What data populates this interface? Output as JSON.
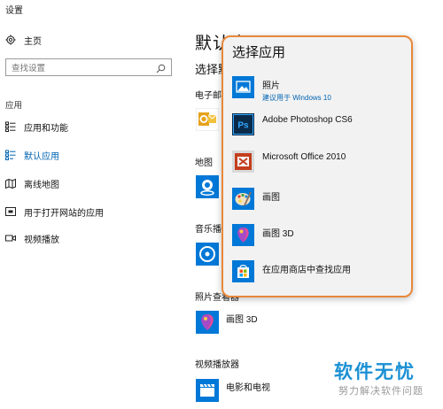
{
  "window": {
    "title": "设置"
  },
  "sidebar": {
    "home_label": "主页",
    "search_placeholder": "查找设置",
    "section_label": "应用",
    "items": [
      {
        "label": "应用和功能",
        "icon": "apps-list-icon"
      },
      {
        "label": "默认应用",
        "icon": "default-apps-icon",
        "active": true
      },
      {
        "label": "离线地图",
        "icon": "offline-map-icon"
      },
      {
        "label": "用于打开网站的应用",
        "icon": "website-apps-icon"
      },
      {
        "label": "视频播放",
        "icon": "video-icon"
      }
    ]
  },
  "main": {
    "title": "默认应用",
    "subtitle": "选择默认应用",
    "categories": [
      {
        "label": "电子邮件"
      },
      {
        "label": "地图"
      },
      {
        "label": "音乐播放器"
      },
      {
        "label": "照片查看器",
        "app": "画图 3D"
      },
      {
        "label": "视频播放器",
        "app": "电影和电视"
      }
    ]
  },
  "flyout": {
    "title": "选择应用",
    "items": [
      {
        "name": "照片",
        "sub": "建议用于 Windows 10",
        "icon": "photos-icon"
      },
      {
        "name": "Adobe Photoshop CS6",
        "icon": "photoshop-icon"
      },
      {
        "name": "Microsoft Office 2010",
        "icon": "office-icon"
      },
      {
        "name": "画图",
        "icon": "paint-icon"
      },
      {
        "name": "画图 3D",
        "icon": "paint3d-icon"
      },
      {
        "name": "在应用商店中查找应用",
        "icon": "store-icon"
      }
    ]
  },
  "watermark": {
    "line1": "软件无忧",
    "line2": "努力解决软件问题"
  },
  "colors": {
    "accent": "#0063b1",
    "highlight_border": "#e8883a"
  }
}
